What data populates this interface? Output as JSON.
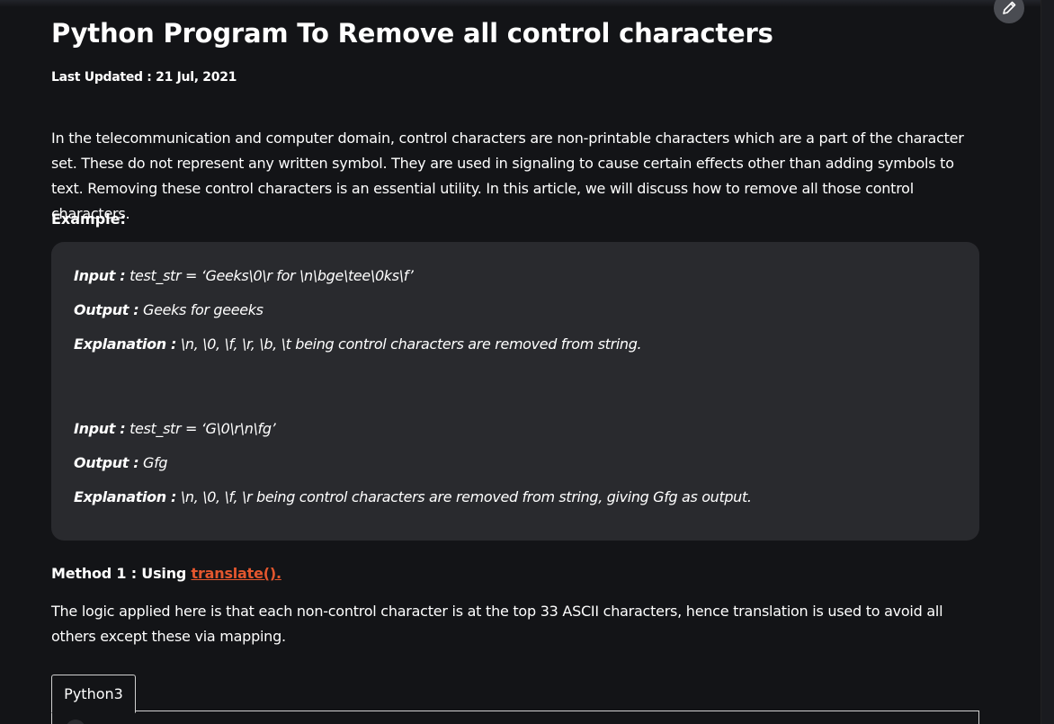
{
  "article": {
    "title": "Python Program To Remove all control characters",
    "last_updated": "Last Updated : 21 Jul, 2021",
    "intro": "In the telecommunication and computer domain, control characters are non-printable characters which are a part of the character set. These do not represent any written symbol. They are used in signaling to cause certain effects other than adding symbols to text. Removing these control characters is an essential utility. In this article, we will discuss how to remove all those control characters.",
    "example_label": "Example:",
    "examples": [
      {
        "input_label": "Input :",
        "input_value": " test_str = ‘Geeks\\0\\r for \\n\\bge\\tee\\0ks\\f’",
        "output_label": "Output :",
        "output_value": " Geeks for geeeks",
        "explanation_label": "Explanation :",
        "explanation_value": " \\n, \\0, \\f, \\r, \\b, \\t being control characters are removed from string."
      },
      {
        "input_label": "Input :",
        "input_value": " test_str = ‘G\\0\\r\\n\\fg’",
        "output_label": "Output :",
        "output_value": " Gfg",
        "explanation_label": "Explanation :",
        "explanation_value": " \\n, \\0, \\f, \\r being control characters are removed from string, giving Gfg as output."
      }
    ],
    "method_prefix": "Method 1 : Using ",
    "method_link": "translate().",
    "logic": "The logic applied here is that each non-control character is at the top 33 ASCII characters, hence translation is used to avoid all others except these via mapping.",
    "code_tab": "Python3"
  },
  "colors": {
    "background": "#131417",
    "example_box": "#292a2e",
    "link": "#e4572e",
    "text": "#ffffff"
  },
  "icons": {
    "edit": "pencil-icon"
  }
}
